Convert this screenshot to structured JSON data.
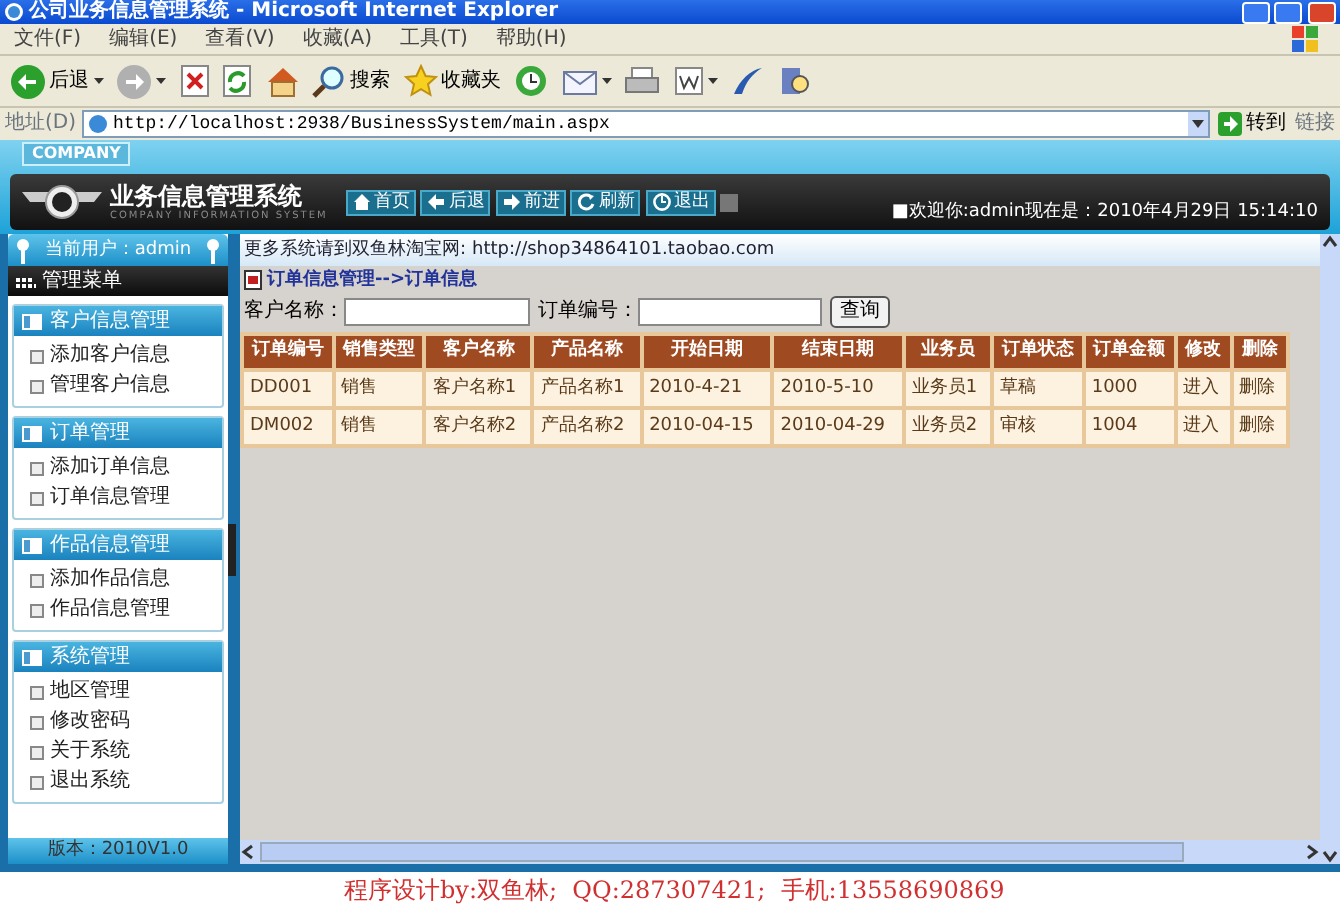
{
  "window": {
    "title": "公司业务信息管理系统 - Microsoft Internet Explorer"
  },
  "menu_bar": [
    "文件(F)",
    "编辑(E)",
    "查看(V)",
    "收藏(A)",
    "工具(T)",
    "帮助(H)"
  ],
  "toolbar": {
    "back": "后退",
    "search": "搜索",
    "favorites": "收藏夹"
  },
  "address_bar": {
    "label": "地址(D)",
    "url": "http://localhost:2938/BusinessSystem/main.aspx",
    "go": "转到",
    "links": "链接"
  },
  "header": {
    "company": "COMPANY",
    "title": "业务信息管理系统",
    "subtitle": "COMPANY INFORMATION SYSTEM",
    "nav_buttons": [
      "首页",
      "后退",
      "前进",
      "刷新",
      "退出"
    ],
    "welcome": "■欢迎你:",
    "user": "admin",
    "clock": "现在是：2010年4月29日  15:14:10"
  },
  "sidebar": {
    "current_user": "当前用户：admin",
    "menu_title": "管理菜单",
    "groups": [
      {
        "title": "客户信息管理",
        "items": [
          "添加客户信息",
          "管理客户信息"
        ]
      },
      {
        "title": "订单管理",
        "items": [
          "添加订单信息",
          "订单信息管理"
        ]
      },
      {
        "title": "作品信息管理",
        "items": [
          "添加作品信息",
          "作品信息管理"
        ]
      },
      {
        "title": "系统管理",
        "items": [
          "地区管理",
          "修改密码",
          "关于系统",
          "退出系统"
        ]
      }
    ],
    "version": "版本：2010V1.0"
  },
  "content": {
    "notice": "更多系统请到双鱼林淘宝网:",
    "notice_link": "http://shop34864101.taobao.com",
    "breadcrumb": "订单信息管理-->订单信息",
    "filters": [
      {
        "label": "客户名称："
      },
      {
        "label": "订单编号："
      }
    ],
    "query_button": "查询",
    "table": {
      "columns": [
        "订单编号",
        "销售类型",
        "客户名称",
        "产品名称",
        "开始日期",
        "结束日期",
        "业务员",
        "订单状态",
        "订单金额",
        "修改",
        "删除"
      ],
      "rows": [
        {
          "cells": [
            "DD001",
            "销售",
            "客户名称1",
            "产品名称1",
            "2010-4-21",
            "2010-5-10",
            "业务员1",
            "草稿",
            "1000"
          ],
          "actions": [
            "进入",
            "删除"
          ]
        },
        {
          "cells": [
            "DM002",
            "销售",
            "客户名称2",
            "产品名称2",
            "2010-04-15",
            "2010-04-29",
            "业务员2",
            "审核",
            "1004"
          ],
          "actions": [
            "进入",
            "删除"
          ]
        }
      ]
    }
  },
  "footer": "程序设计by:双鱼林;  QQ:287307421;  手机:13558690869"
}
